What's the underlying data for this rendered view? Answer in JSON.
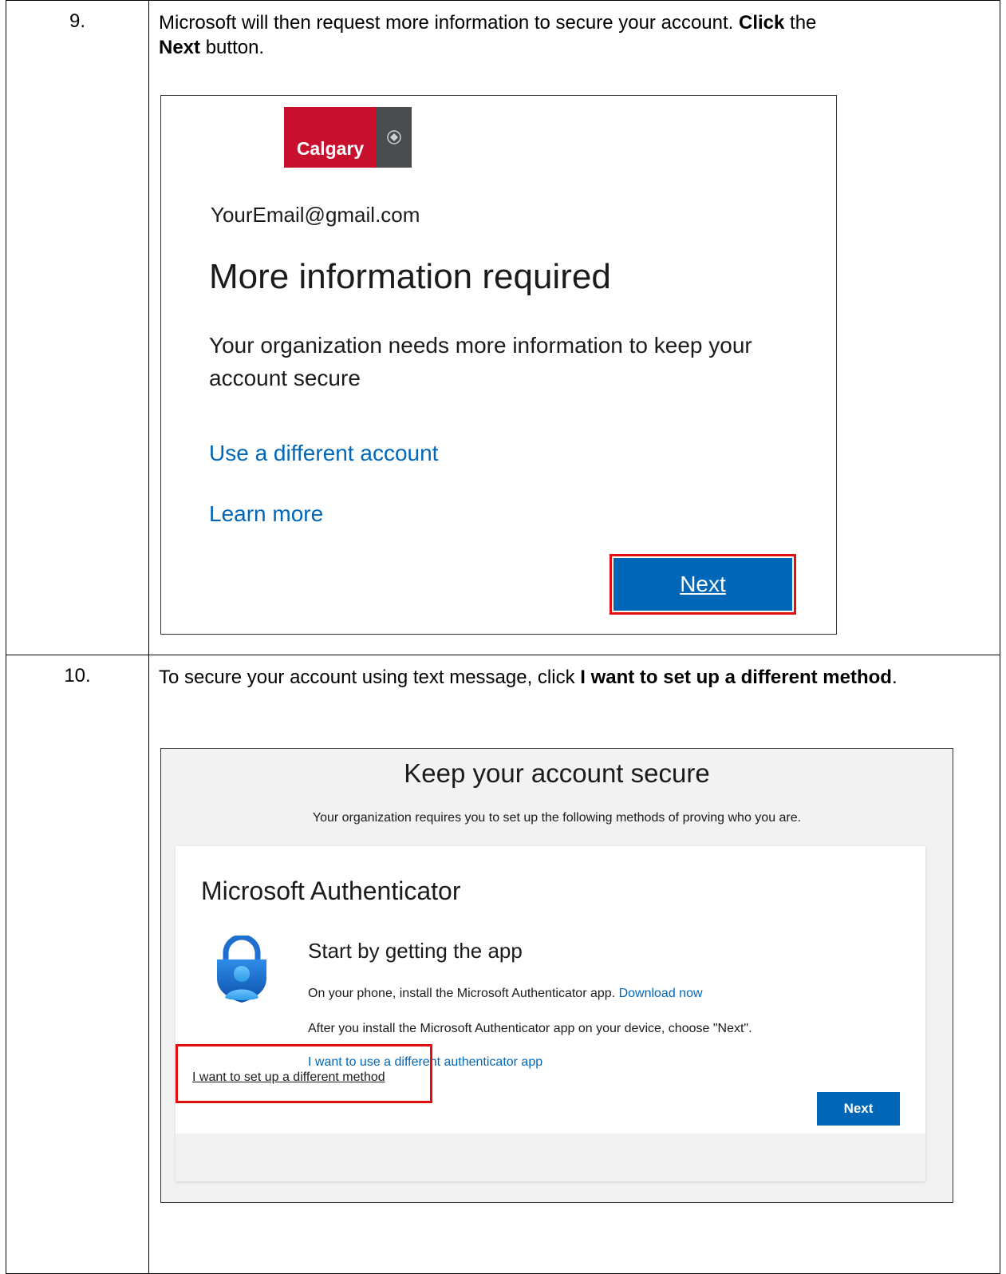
{
  "steps": [
    {
      "number": "9.",
      "instruction": {
        "pre": "Microsoft will then request more information to secure your account. ",
        "bold1": "Click",
        "mid": " the ",
        "bold2": "Next",
        "post": " button."
      },
      "screenshot": {
        "logo_text": "Calgary",
        "email": "YourEmail@gmail.com",
        "heading": "More information required",
        "description": "Your organization needs more information to keep your account secure",
        "link_different_account": "Use a different account",
        "link_learn_more": "Learn more",
        "next_label": "Next"
      }
    },
    {
      "number": "10.",
      "instruction": {
        "pre": "To secure your account using text message, click ",
        "bold1": "I want to set up a different method",
        "post": "."
      },
      "screenshot": {
        "title": "Keep your account secure",
        "description": "Your organization requires you to set up the following methods of proving who you are.",
        "card_title": "Microsoft Authenticator",
        "start_heading": "Start by getting the app",
        "install_text": "On your phone, install the Microsoft Authenticator app.",
        "download_link": "Download now",
        "after_install_text": "After you install the Microsoft Authenticator app on your device, choose \"Next\".",
        "different_app_link": "I want to use a different authenticator app",
        "next_label": "Next",
        "different_method_link": "I want to set up a different method"
      }
    }
  ],
  "colors": {
    "calgary_red": "#c8102e",
    "microsoft_blue": "#0067b8",
    "highlight_red": "#e01010"
  }
}
